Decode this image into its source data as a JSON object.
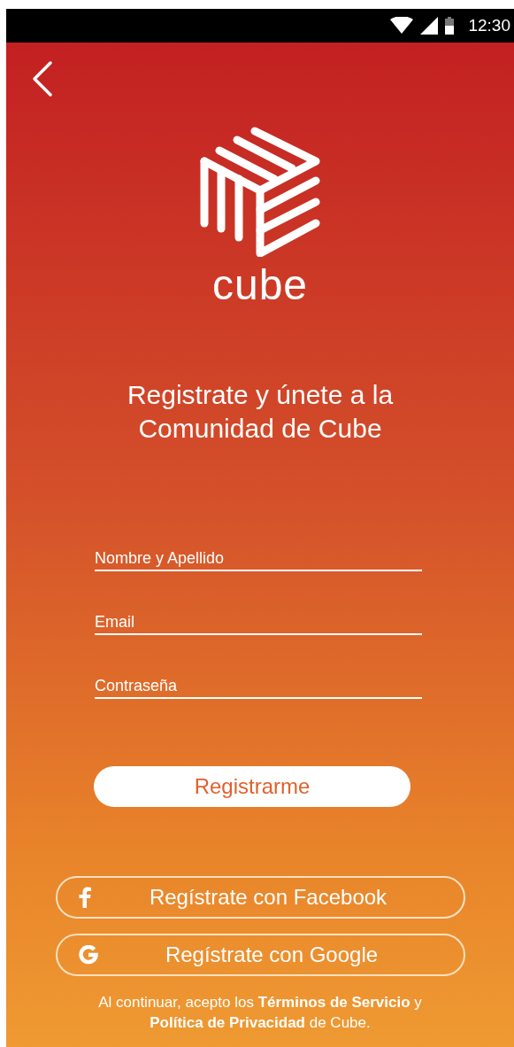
{
  "status_bar": {
    "time": "12:30"
  },
  "logo": {
    "wordmark": "cube"
  },
  "headline": [
    "Registrate y únete a la",
    "Comunidad de Cube"
  ],
  "fields": [
    {
      "placeholder": "Nombre y Apellido"
    },
    {
      "placeholder": "Email"
    },
    {
      "placeholder": "Contraseña"
    }
  ],
  "submit_button": "Registrarme",
  "social_buttons": [
    {
      "kind": "facebook",
      "label": "Regístrate con Facebook"
    },
    {
      "kind": "google",
      "label": "Regístrate con Google"
    }
  ],
  "terms": "Al continuar, acepto los **Términos de Servicio** y **Política de Privacidad** de Cube."
}
